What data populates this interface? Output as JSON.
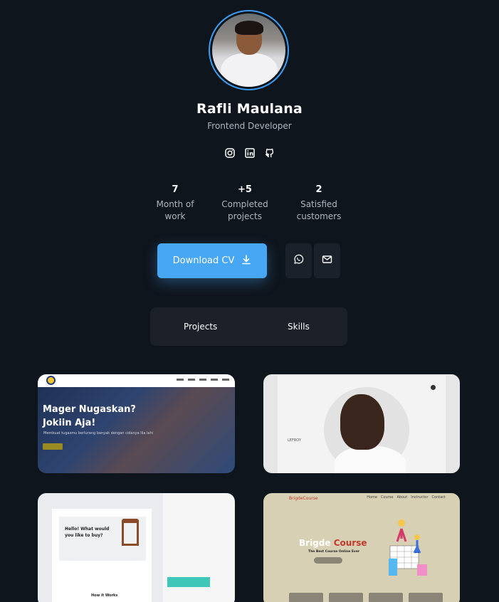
{
  "profile": {
    "name": "Rafli Maulana",
    "role": "Frontend Developer"
  },
  "socials": [
    "instagram-icon",
    "linkedin-icon",
    "github-icon"
  ],
  "stats": [
    {
      "value": "7",
      "label_line1": "Month of",
      "label_line2": "work"
    },
    {
      "value": "+5",
      "label_line1": "Completed",
      "label_line2": "projects"
    },
    {
      "value": "2",
      "label_line1": "Satisfied",
      "label_line2": "customers"
    }
  ],
  "actions": {
    "download_label": "Download CV",
    "icons": [
      "download-icon",
      "whatsapp-icon",
      "mail-icon"
    ]
  },
  "tabs": [
    {
      "label": "Projects"
    },
    {
      "label": "Skills"
    }
  ],
  "projects": [
    {
      "headline_line1": "Mager Nugaskan?",
      "headline_line2": "Jokiin Aja!",
      "subtext": "Membuat tugasmu berlurang banyak dengan cidanya lila lahi"
    },
    {
      "label": "LEFROY"
    },
    {
      "headline_line1": "Hello! What would",
      "headline_line2": "you like to buy?",
      "footer": "How it Works"
    },
    {
      "brand": "BrigdeCourse",
      "nav": [
        "Home",
        "Course",
        "About",
        "Instructor",
        "Contact"
      ],
      "title_part1": "Brigde",
      "title_part2": "Course",
      "tagline": "The Best Course Online Ever"
    }
  ],
  "colors": {
    "background": "#0f151d",
    "accent": "#47a7f5",
    "card_dark": "#1b2029"
  }
}
